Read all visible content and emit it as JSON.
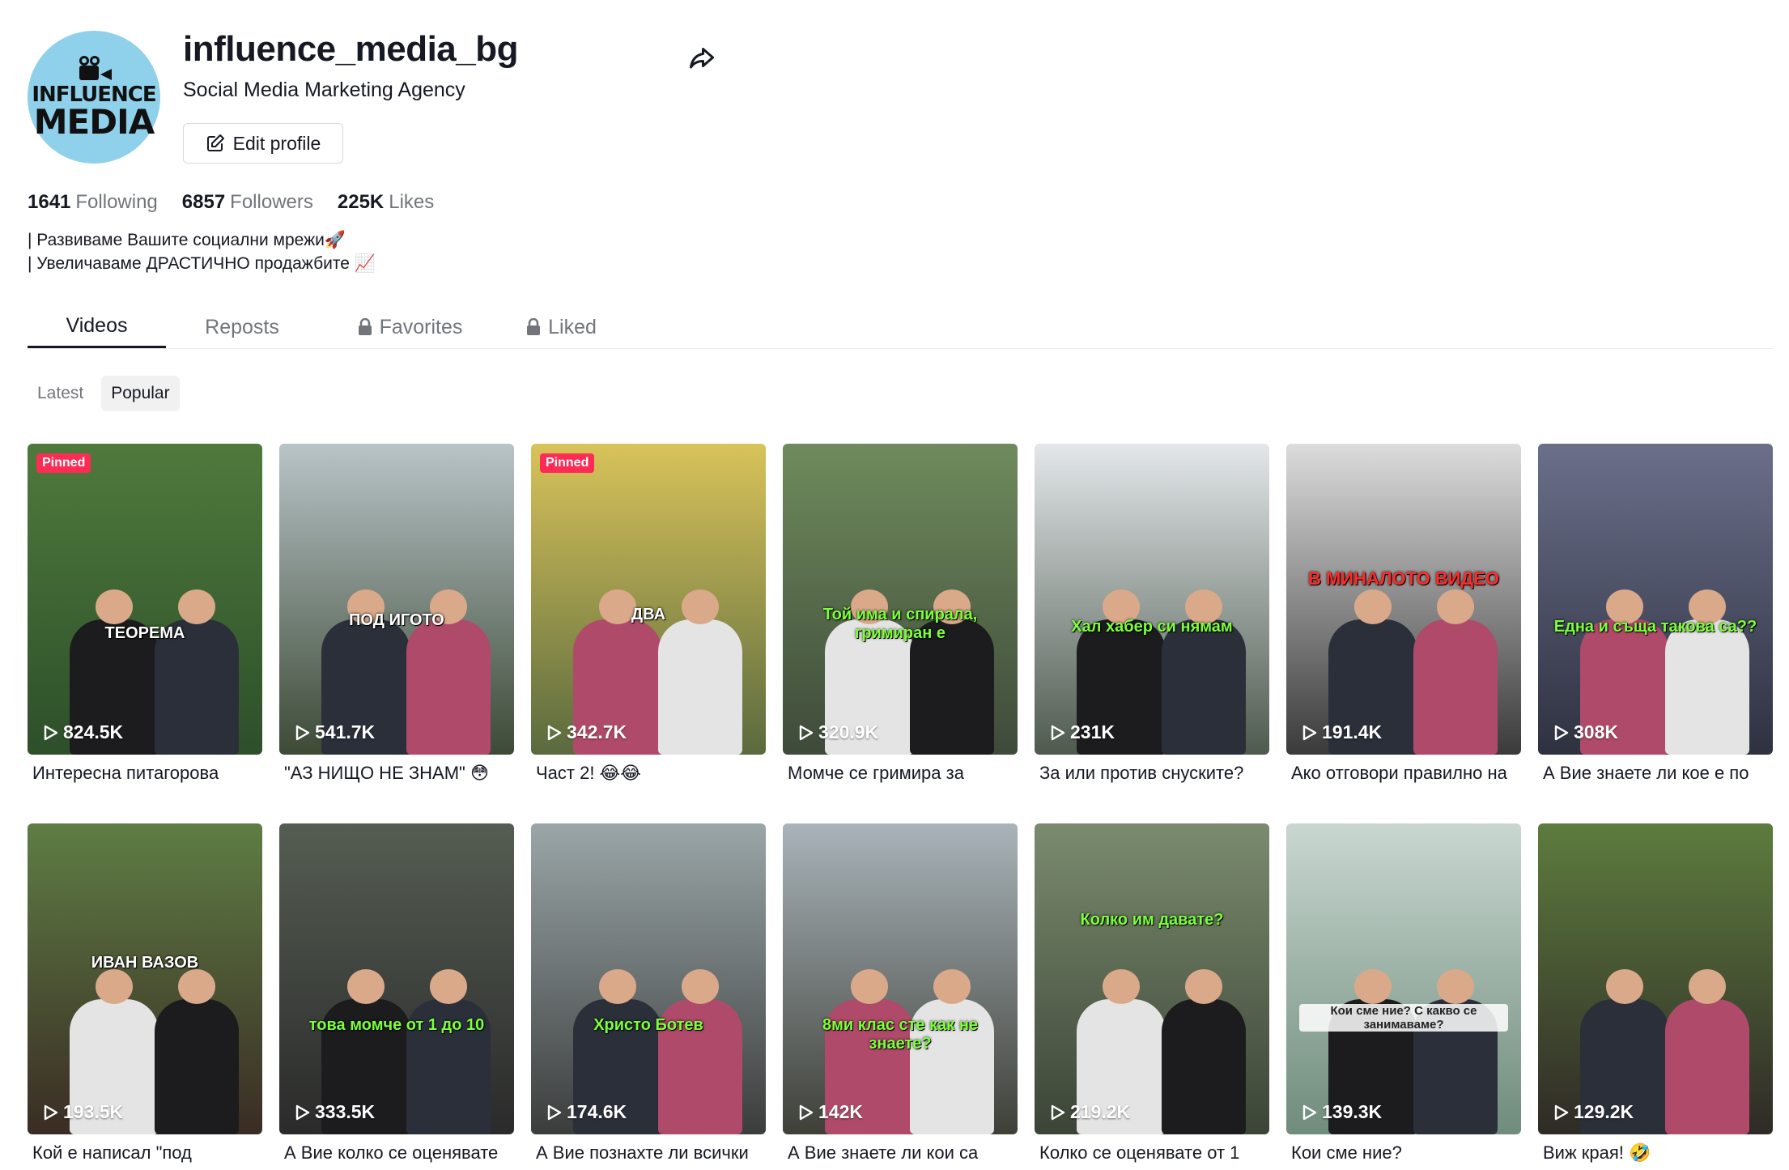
{
  "profile": {
    "username": "influence_media_bg",
    "nickname": "Social Media Marketing Agency",
    "edit_label": "Edit profile",
    "avatar_line1": "INFLUENCE",
    "avatar_line2": "MEDIA",
    "avatar_bg": "#8fd0ea",
    "stats": {
      "following": "1641",
      "following_label": "Following",
      "followers": "6857",
      "followers_label": "Followers",
      "likes": "225K",
      "likes_label": "Likes"
    },
    "bio": [
      "| Развиваме Вашите социални мрежи🚀",
      "| Увеличаваме ДРАСТИЧНО продажбите 📈"
    ]
  },
  "tabs": [
    "Videos",
    "Reposts",
    "Favorites",
    "Liked"
  ],
  "sort": [
    "Latest",
    "Popular"
  ],
  "pinned_label": "Pinned",
  "videos": [
    {
      "views": "824.5K",
      "caption": "Интересна питагорова",
      "pinned": true,
      "overlay": "ТЕОРЕМА",
      "c1": "#4f7a3c",
      "c2": "#2d4f2a"
    },
    {
      "views": "541.7K",
      "caption": "\"АЗ НИЩО НЕ ЗНАМ\" 😳",
      "pinned": false,
      "overlay": "ПОД ИГОТО",
      "c1": "#b9c4c8",
      "c2": "#3c4a36"
    },
    {
      "views": "342.7K",
      "caption": "Част 2! 😂😂",
      "pinned": true,
      "overlay": "ДВА",
      "c1": "#d9c35a",
      "c2": "#5a6a3e"
    },
    {
      "views": "320.9K",
      "caption": "Момче се гримира за",
      "pinned": false,
      "overlay": "Той има и спирала, гримиран е",
      "c1": "#6f8b5c",
      "c2": "#3e4a3a"
    },
    {
      "views": "231K",
      "caption": "За или против снуските?",
      "pinned": false,
      "overlay": "Хал хабер си нямам",
      "c1": "#e3e7ea",
      "c2": "#4e5a4e"
    },
    {
      "views": "191.4K",
      "caption": "Ако отговори правилно на",
      "pinned": false,
      "overlay": "В МИНАЛОТО ВИДЕО",
      "c1": "#dcdcdc",
      "c2": "#3a3a3a"
    },
    {
      "views": "308K",
      "caption": "А Вие знаете ли кое е по",
      "pinned": false,
      "overlay": "Една и съща такова са??",
      "c1": "#6b6f8a",
      "c2": "#2e3140"
    },
    {
      "views": "193.5K",
      "caption": "Кой е написал \"под",
      "pinned": false,
      "overlay": "ИВАН ВАЗОВ",
      "c1": "#5e7d44",
      "c2": "#3a2c24"
    },
    {
      "views": "333.5K",
      "caption": "А Вие колко се оценявате",
      "pinned": false,
      "overlay": "това момче от 1 до 10",
      "c1": "#555d52",
      "c2": "#2a2a2a"
    },
    {
      "views": "174.6K",
      "caption": "А Вие познахте ли всички",
      "pinned": false,
      "overlay": "Христо Ботев",
      "c1": "#9aa6a8",
      "c2": "#3b3d3c"
    },
    {
      "views": "142K",
      "caption": "А Вие знаете ли кои са",
      "pinned": false,
      "overlay": "8ми клас сте как не знаете?",
      "c1": "#a9b4ba",
      "c2": "#3e4038"
    },
    {
      "views": "219.2K",
      "caption": "Колко се оценявате от 1",
      "pinned": false,
      "overlay": "Колко им давате?",
      "c1": "#7a8b6e",
      "c2": "#3b4436"
    },
    {
      "views": "139.3K",
      "caption": "Кои сме ние?",
      "pinned": false,
      "overlay": "Кои сме ние? С какво се занимаваме?",
      "c1": "#c9d7d0",
      "c2": "#6f8c7c"
    },
    {
      "views": "129.2K",
      "caption": "Виж края! 🤣",
      "pinned": false,
      "overlay": "",
      "c1": "#5d7c3e",
      "c2": "#2f2a26"
    }
  ]
}
